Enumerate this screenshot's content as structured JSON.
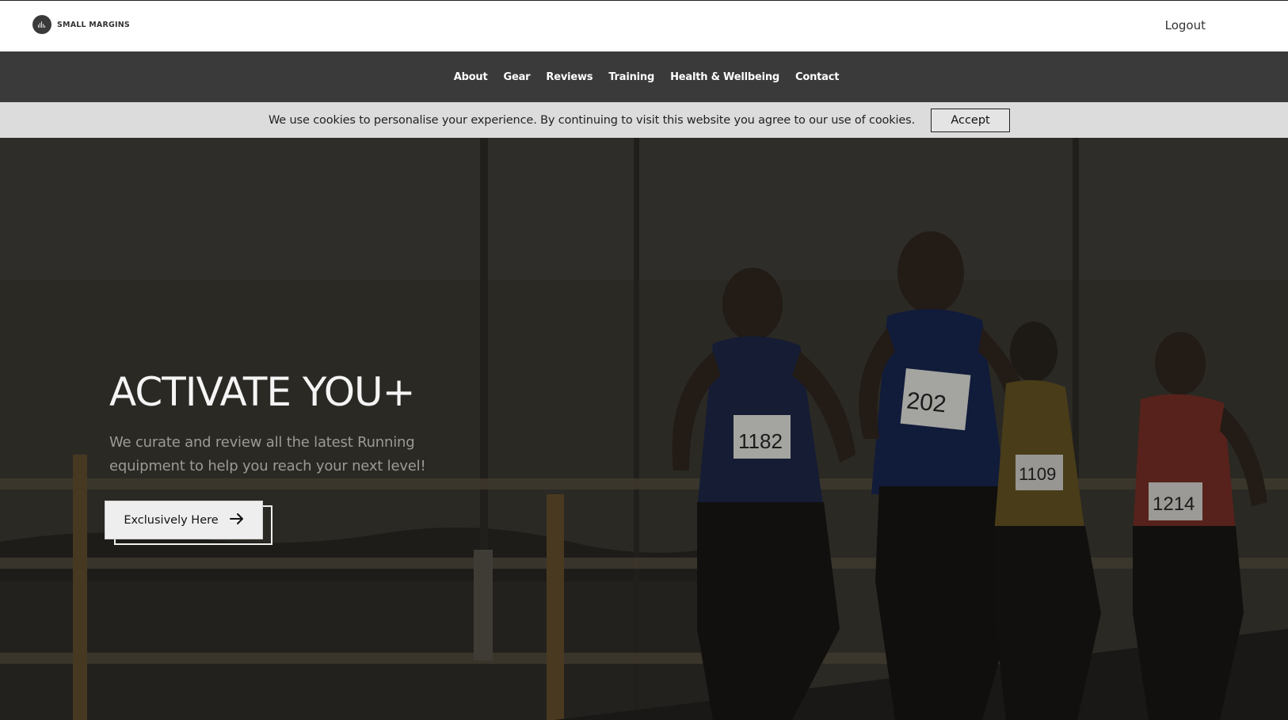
{
  "header": {
    "logo_text": "SMALL MARGINS",
    "logout_label": "Logout"
  },
  "nav": {
    "items": [
      "About",
      "Gear",
      "Reviews",
      "Training",
      "Health & Wellbeing",
      "Contact"
    ]
  },
  "cookie_banner": {
    "message": "We use cookies to personalise your experience. By continuing to visit this website you agree to our use of cookies.",
    "accept_label": "Accept"
  },
  "hero": {
    "title": "ACTIVATE YOU+",
    "subtitle": "We curate and review all the latest Running equipment to help you reach your next level!",
    "cta_label": "Exclusively Here",
    "cta_icon": "arrow-right-icon",
    "bib_numbers": [
      "1182",
      "202",
      "1109",
      "1214"
    ]
  },
  "colors": {
    "nav_bg": "#3a3a3a",
    "cookie_bg": "#dcdcdc",
    "hero_overlay": "#2f2d28",
    "cta_bg": "#eeeeee"
  }
}
